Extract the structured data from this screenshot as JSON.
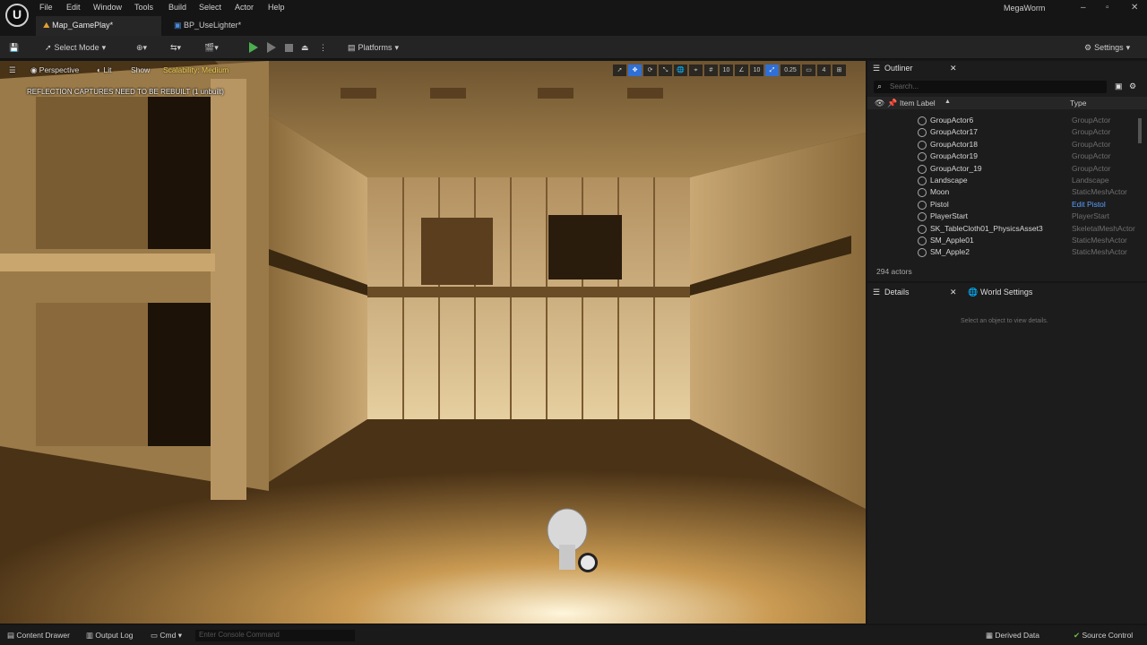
{
  "menu": [
    "File",
    "Edit",
    "Window",
    "Tools",
    "Build",
    "Select",
    "Actor",
    "Help"
  ],
  "project_name": "MegaWorm",
  "tabs": [
    {
      "label": "Map_GamePlay*",
      "active": true
    },
    {
      "label": "BP_UseLighter*",
      "active": false
    }
  ],
  "toolbar": {
    "select_mode": "Select Mode",
    "platforms": "Platforms",
    "settings": "Settings"
  },
  "viewport": {
    "perspective": "Perspective",
    "lit": "Lit",
    "show": "Show",
    "scalability": "Scalability: Medium",
    "warning": "REFLECTION CAPTURES NEED TO BE REBUILT (1 unbuilt)",
    "grid_size": "10",
    "rotation_snap": "10",
    "scale_snap": "0.25",
    "camera_speed": "4"
  },
  "outliner": {
    "title": "Outliner",
    "search_placeholder": "Search...",
    "col_label": "Item Label",
    "col_type": "Type",
    "rows": [
      {
        "name": "GroupActor6",
        "type": "GroupActor"
      },
      {
        "name": "GroupActor17",
        "type": "GroupActor"
      },
      {
        "name": "GroupActor18",
        "type": "GroupActor"
      },
      {
        "name": "GroupActor19",
        "type": "GroupActor"
      },
      {
        "name": "GroupActor_19",
        "type": "GroupActor"
      },
      {
        "name": "Landscape",
        "type": "Landscape"
      },
      {
        "name": "Moon",
        "type": "StaticMeshActor"
      },
      {
        "name": "Pistol",
        "type": "Edit Pistol"
      },
      {
        "name": "PlayerStart",
        "type": "PlayerStart"
      },
      {
        "name": "SK_TableCloth01_PhysicsAsset3",
        "type": "SkeletalMeshActor"
      },
      {
        "name": "SM_Apple01",
        "type": "StaticMeshActor"
      },
      {
        "name": "SM_Apple2",
        "type": "StaticMeshActor"
      }
    ],
    "actor_count": "294 actors"
  },
  "details": {
    "tab": "Details",
    "world_settings": "World Settings",
    "hint": "Select an object to view details."
  },
  "statusbar": {
    "content_drawer": "Content Drawer",
    "output_log": "Output Log",
    "cmd": "Cmd",
    "console_placeholder": "Enter Console Command",
    "derived_data": "Derived Data",
    "source_control": "Source Control"
  }
}
